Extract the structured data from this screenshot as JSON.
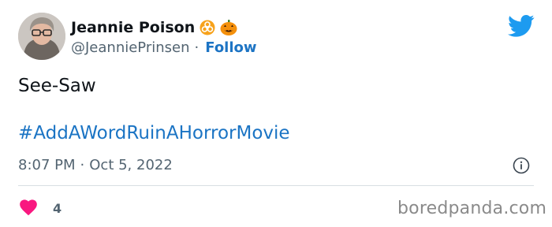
{
  "user": {
    "display_name": "Jeannie Poison",
    "handle": "@JeanniePrinsen",
    "follow_label": "Follow",
    "separator": "·",
    "name_emojis": [
      "biohazard-emoji",
      "jack-o-lantern-emoji"
    ]
  },
  "tweet": {
    "text": "See-Saw",
    "hashtag": "#AddAWordRuinAHorrorMovie",
    "time": "8:07 PM",
    "date": "Oct 5, 2022",
    "separator": "·"
  },
  "actions": {
    "like_count": "4",
    "like_icon": "heart-icon"
  },
  "brand": {
    "platform_icon": "twitter-bird-icon",
    "info_icon": "info-icon"
  },
  "watermark": "boredpanda.com",
  "colors": {
    "link_blue": "#1d74c4",
    "twitter_blue": "#1d9bf0",
    "heart_pink": "#f91880",
    "secondary_text": "#536471"
  }
}
